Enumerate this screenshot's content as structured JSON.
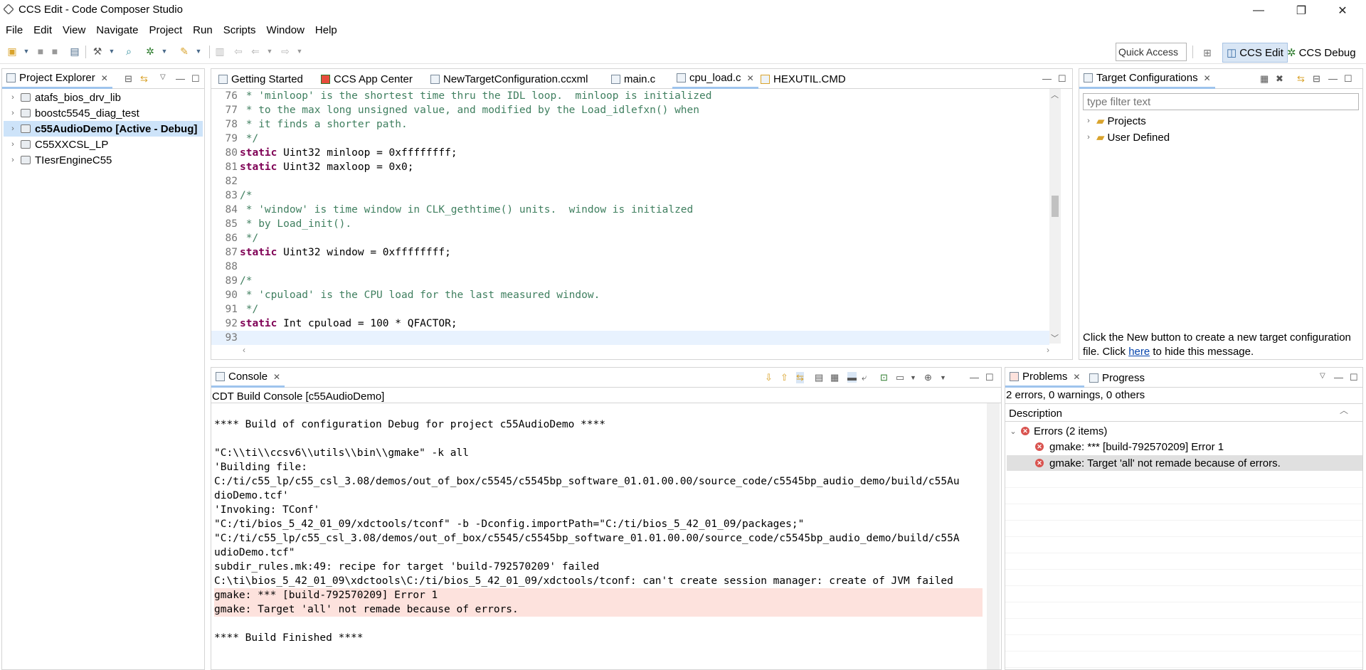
{
  "window": {
    "title": "CCS Edit - Code Composer Studio",
    "minimize": "—",
    "restore": "❐",
    "close": "✕"
  },
  "menu": [
    "File",
    "Edit",
    "View",
    "Navigate",
    "Project",
    "Run",
    "Scripts",
    "Window",
    "Help"
  ],
  "toolbar": {
    "quick_access": "Quick Access",
    "perspectives": [
      "CCS Edit",
      "CCS Debug"
    ]
  },
  "project_explorer": {
    "tab_label": "Project Explorer",
    "items": [
      {
        "label": "atafs_bios_drv_lib",
        "bold": false
      },
      {
        "label": "boostc5545_diag_test",
        "bold": false
      },
      {
        "label": "c55AudioDemo  [Active - Debug]",
        "bold": true
      },
      {
        "label": "C55XXCSL_LP",
        "bold": false
      },
      {
        "label": "TIesrEngineC55",
        "bold": false
      }
    ]
  },
  "editor": {
    "tabs": [
      "Getting Started",
      "CCS App Center",
      "NewTargetConfiguration.ccxml",
      "main.c",
      "cpu_load.c",
      "HEXUTIL.CMD"
    ],
    "active_tab": "cpu_load.c",
    "lines": [
      {
        "num": "76",
        "kind": "comment",
        "text": " * 'minloop' is the shortest time thru the IDL loop.  minloop is initialized"
      },
      {
        "num": "77",
        "kind": "comment",
        "text": " * to the max long unsigned value, and modified by the Load_idlefxn() when"
      },
      {
        "num": "78",
        "kind": "comment",
        "text": " * it finds a shorter path."
      },
      {
        "num": "79",
        "kind": "comment",
        "text": " */"
      },
      {
        "num": "80",
        "kind": "code",
        "kw": "static",
        "text": " Uint32 minloop = 0xffffffff;"
      },
      {
        "num": "81",
        "kind": "code",
        "kw": "static",
        "text": " Uint32 maxloop = 0x0;"
      },
      {
        "num": "82",
        "kind": "blank",
        "text": ""
      },
      {
        "num": "83",
        "kind": "comment",
        "text": "/*"
      },
      {
        "num": "84",
        "kind": "comment",
        "text": " * 'window' is time window in CLK_gethtime() units.  window is initialzed"
      },
      {
        "num": "85",
        "kind": "comment",
        "text": " * by Load_init()."
      },
      {
        "num": "86",
        "kind": "comment",
        "text": " */"
      },
      {
        "num": "87",
        "kind": "code",
        "kw": "static",
        "text": " Uint32 window = 0xffffffff;"
      },
      {
        "num": "88",
        "kind": "blank",
        "text": ""
      },
      {
        "num": "89",
        "kind": "comment",
        "text": "/*"
      },
      {
        "num": "90",
        "kind": "comment",
        "text": " * 'cpuload' is the CPU load for the last measured window."
      },
      {
        "num": "91",
        "kind": "comment",
        "text": " */"
      },
      {
        "num": "92",
        "kind": "code",
        "kw": "static",
        "text": " Int cpuload = 100 * QFACTOR;"
      },
      {
        "num": "93",
        "kind": "current",
        "text": ""
      }
    ]
  },
  "target_configurations": {
    "tab_label": "Target Configurations",
    "filter_placeholder": "type filter text",
    "items": [
      "Projects",
      "User Defined"
    ],
    "message_prefix": "Click the New button to create a new target configuration file. Click ",
    "message_link": "here",
    "message_suffix": " to hide this message."
  },
  "console": {
    "tab_label": "Console",
    "title": "CDT Build Console [c55AudioDemo]",
    "lines": [
      {
        "text": "",
        "err": false
      },
      {
        "text": "**** Build of configuration Debug for project c55AudioDemo ****",
        "err": false
      },
      {
        "text": "",
        "err": false
      },
      {
        "text": "\"C:\\\\ti\\\\ccsv6\\\\utils\\\\bin\\\\gmake\" -k all",
        "err": false
      },
      {
        "text": "'Building file:",
        "err": false
      },
      {
        "text": "C:/ti/c55_lp/c55_csl_3.08/demos/out_of_box/c5545/c5545bp_software_01.01.00.00/source_code/c5545bp_audio_demo/build/c55Au",
        "err": false
      },
      {
        "text": "dioDemo.tcf'",
        "err": false
      },
      {
        "text": "'Invoking: TConf'",
        "err": false
      },
      {
        "text": "\"C:/ti/bios_5_42_01_09/xdctools/tconf\" -b -Dconfig.importPath=\"C:/ti/bios_5_42_01_09/packages;\"",
        "err": false
      },
      {
        "text": "\"C:/ti/c55_lp/c55_csl_3.08/demos/out_of_box/c5545/c5545bp_software_01.01.00.00/source_code/c5545bp_audio_demo/build/c55A",
        "err": false
      },
      {
        "text": "udioDemo.tcf\"",
        "err": false
      },
      {
        "text": "subdir_rules.mk:49: recipe for target 'build-792570209' failed",
        "err": false
      },
      {
        "text": "C:\\ti\\bios_5_42_01_09\\xdctools\\C:/ti/bios_5_42_01_09/xdctools/tconf: can't create session manager: create of JVM failed",
        "err": false
      },
      {
        "text": "gmake: *** [build-792570209] Error 1",
        "err": true
      },
      {
        "text": "gmake: Target 'all' not remade because of errors.",
        "err": true
      },
      {
        "text": "",
        "err": false
      },
      {
        "text": "**** Build Finished ****",
        "err": false
      }
    ]
  },
  "problems": {
    "tab_label": "Problems",
    "progress_tab_label": "Progress",
    "summary": "2 errors, 0 warnings, 0 others",
    "column": "Description",
    "group": "Errors (2 items)",
    "errors": [
      "gmake: *** [build-792570209] Error 1",
      "gmake: Target 'all' not remade because of errors."
    ]
  }
}
